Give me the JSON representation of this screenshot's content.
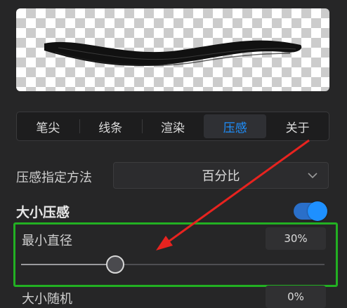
{
  "tabs": [
    "笔尖",
    "线条",
    "渲染",
    "压感",
    "关于"
  ],
  "active_tab": "压感",
  "pressure_mode": {
    "label": "压感指定方法",
    "value": "百分比"
  },
  "size_pressure": {
    "title": "大小压感",
    "enabled": true
  },
  "min_diameter": {
    "label": "最小直径",
    "value": "30%",
    "level": 0.31
  },
  "size_random": {
    "label": "大小随机",
    "value": "0%"
  },
  "colors": {
    "accent": "#1e90ff",
    "highlight": "#22b022",
    "arrow": "#e8231f"
  },
  "icons": {
    "dropdown": "chevron-down-icon",
    "annotation": "arrow-annotation"
  }
}
